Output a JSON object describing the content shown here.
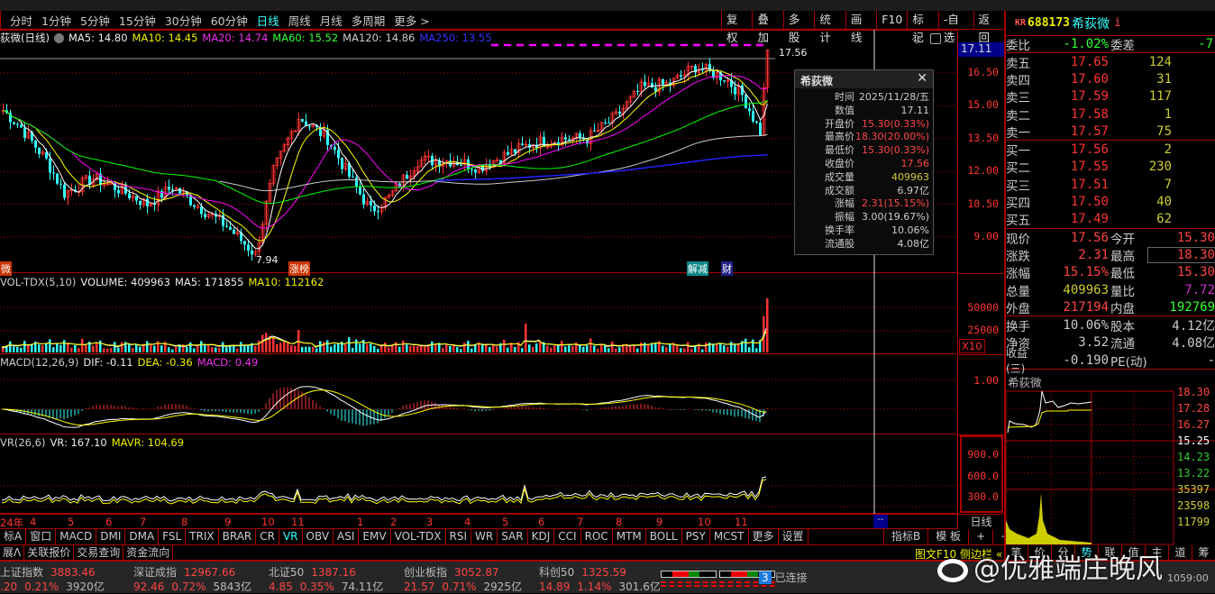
{
  "toolbar": {
    "periods": [
      "分时",
      "1分钟",
      "5分钟",
      "15分钟",
      "30分钟",
      "60分钟",
      "日线",
      "周线",
      "月线",
      "多周期",
      "更多 >"
    ],
    "active": "日线",
    "buttons": [
      "复权",
      "叠加",
      "多股",
      "统计",
      "画线",
      "F10",
      "标记",
      "-自选",
      "返回"
    ]
  },
  "ma_legend": {
    "title": "荻微(日线)",
    "ma5": "MA5: 14.80",
    "ma10": "MA10: 14.45",
    "ma20": "MA20: 14.74",
    "ma60": "MA60: 15.52",
    "ma120": "MA120: 14.86",
    "ma250": "MA250: 13.55"
  },
  "price_axis": {
    "current": "17.11",
    "ticks": [
      "16.50",
      "15.00",
      "13.50",
      "12.00",
      "10.50",
      "9.00"
    ]
  },
  "annotations": {
    "high": "17.56",
    "low": "7.94",
    "tag1": "涨榜",
    "tag2": "解减",
    "tag3": "财",
    "left": "微"
  },
  "colors": {
    "up": "#ff3333",
    "down": "#33ffff",
    "ma5": "#ffffff",
    "ma10": "#ffff00",
    "ma20": "#ff00ff",
    "ma60": "#00ff00",
    "ma120": "#cccccc",
    "ma250": "#2222ff"
  },
  "price_path": [
    [
      0,
      14.8
    ],
    [
      5,
      14.0
    ],
    [
      12,
      12.5
    ],
    [
      17,
      11.0
    ],
    [
      25,
      11.7
    ],
    [
      32,
      11.2
    ],
    [
      40,
      10.5
    ],
    [
      47,
      11.3
    ],
    [
      55,
      10.3
    ],
    [
      62,
      9.5
    ],
    [
      70,
      8.2
    ],
    [
      75,
      12.0
    ],
    [
      82,
      14.5
    ],
    [
      90,
      13.5
    ],
    [
      97,
      11.5
    ],
    [
      102,
      10.2
    ],
    [
      107,
      10.8
    ],
    [
      115,
      12.5
    ],
    [
      125,
      12.5
    ],
    [
      132,
      12.2
    ],
    [
      140,
      12.8
    ],
    [
      147,
      13.3
    ],
    [
      155,
      13.5
    ],
    [
      162,
      13.5
    ],
    [
      170,
      14.5
    ],
    [
      177,
      15.8
    ],
    [
      185,
      16.0
    ],
    [
      192,
      16.8
    ],
    [
      200,
      16.3
    ],
    [
      205,
      15.5
    ],
    [
      210,
      13.8
    ],
    [
      212,
      17.56
    ]
  ],
  "volume": {
    "label": "VOL-TDX(5,10)",
    "volume": "VOLUME: 409963",
    "ma5": "MA5: 171855",
    "ma10": "MA10: 112162",
    "ticks": [
      "50000",
      "25000"
    ],
    "unit": "X10"
  },
  "macd": {
    "label": "MACD(12,26,9)",
    "dif": "DIF: -0.11",
    "dea": "DEA: -0.36",
    "macd": "MACD: 0.49",
    "ticks": [
      "1.00"
    ]
  },
  "vr": {
    "label": "VR(26,6)",
    "vr": "VR: 167.10",
    "mavr": "MAVR: 104.69",
    "ticks": [
      "900.0",
      "600.0",
      "300.0"
    ]
  },
  "dates": [
    "24年",
    "4",
    "5",
    "6",
    "7",
    "8",
    "9",
    "10",
    "11",
    "1",
    "2",
    "3",
    "4",
    "5",
    "6",
    "7",
    "8",
    "9",
    "10",
    "11"
  ],
  "period_label": "日线",
  "tooltip": {
    "title": "希荻微",
    "rows": [
      [
        "时间",
        "2025/11/28/五"
      ],
      [
        "数值",
        "17.11"
      ],
      [
        "开盘价",
        "15.30(0.33%)"
      ],
      [
        "最高价",
        "18.30(20.00%)"
      ],
      [
        "最低价",
        "15.30(0.33%)"
      ],
      [
        "收盘价",
        "17.56"
      ],
      [
        "成交量",
        "409963"
      ],
      [
        "成交额",
        "6.97亿"
      ],
      [
        "涨幅",
        "2.31(15.15%)"
      ],
      [
        "振幅",
        "3.00(19.67%)"
      ],
      [
        "换手率",
        "10.06%"
      ],
      [
        "流通股",
        "4.08亿"
      ]
    ]
  },
  "indicator_tabs": [
    "标A",
    "窗口",
    "MACD",
    "DMI",
    "DMA",
    "FSL",
    "TRIX",
    "BRAR",
    "CR",
    "VR",
    "OBV",
    "ASI",
    "EMV",
    "VOL-TDX",
    "RSI",
    "WR",
    "SAR",
    "KDJ",
    "CCI",
    "ROC",
    "MTM",
    "BOLL",
    "PSY",
    "MCST",
    "更多",
    "设置"
  ],
  "indicator_active": "VR",
  "right_tabs": [
    "指标B",
    "模 板",
    "+",
    "−"
  ],
  "bottom_tabs": [
    "展Λ",
    "关联报价",
    "交易查询",
    "资金流向"
  ],
  "bottom_right": {
    "f10": "图文F10",
    "side": "侧边栏 «",
    "tabs": [
      "笔",
      "价",
      "分",
      "势",
      "联",
      "值",
      "主",
      "道",
      "筹"
    ]
  },
  "quote": {
    "badge": "KR",
    "code": "688173",
    "name": "希荻微",
    "info": "i",
    "weibi": {
      "label": "委比",
      "value": "-1.02%",
      "label2": "委差",
      "value2": "-7"
    },
    "sell": [
      [
        "卖五",
        "17.65",
        "124"
      ],
      [
        "卖四",
        "17.60",
        "31"
      ],
      [
        "卖三",
        "17.59",
        "117"
      ],
      [
        "卖二",
        "17.58",
        "1"
      ],
      [
        "卖一",
        "17.57",
        "75"
      ]
    ],
    "buy": [
      [
        "买一",
        "17.56",
        "2"
      ],
      [
        "买二",
        "17.55",
        "230"
      ],
      [
        "买三",
        "17.51",
        "7"
      ],
      [
        "买四",
        "17.50",
        "40"
      ],
      [
        "买五",
        "17.49",
        "62"
      ]
    ],
    "stats": [
      [
        "现价",
        "17.56",
        "今开",
        "15.30"
      ],
      [
        "涨跌",
        "2.31",
        "最高",
        "18.30"
      ],
      [
        "涨幅",
        "15.15%",
        "最低",
        "15.30"
      ],
      [
        "总量",
        "409963",
        "量比",
        "7.72"
      ],
      [
        "外盘",
        "217194",
        "内盘",
        "192769"
      ]
    ],
    "stats2": [
      [
        "换手",
        "10.06%",
        "股本",
        "4.12亿"
      ],
      [
        "净资",
        "3.52",
        "流通",
        "4.08亿"
      ],
      [
        "收益(三)",
        "-0.190",
        "PE(动)",
        "-"
      ]
    ]
  },
  "mini": {
    "title": "希荻微",
    "ticks": [
      "18.30",
      "17.28",
      "16.27",
      "15.25",
      "14.23",
      "13.22"
    ],
    "vol_ticks": [
      "35397",
      "23598",
      "11799"
    ]
  },
  "indices": [
    {
      "name": "上证指数",
      "value": "3883.46",
      "chg": ".20",
      "pct": "0.21%",
      "amt": "3920亿"
    },
    {
      "name": "深证成指",
      "value": "12967.66",
      "chg": "92.46",
      "pct": "0.72%",
      "amt": "5843亿"
    },
    {
      "name": "北证50",
      "value": "1387.16",
      "chg": "4.85",
      "pct": "0.35%",
      "amt": "74.11亿"
    },
    {
      "name": "创业板指",
      "value": "3052.87",
      "chg": "21.57",
      "pct": "0.71%",
      "amt": "2925亿"
    },
    {
      "name": "科创50",
      "value": "1325.59",
      "chg": "14.89",
      "pct": "1.14%",
      "amt": "301.6亿"
    }
  ],
  "connection": {
    "count": "3",
    "text": "已连接"
  },
  "clock": "1059:00",
  "watermark": "@优雅端庄晚风"
}
